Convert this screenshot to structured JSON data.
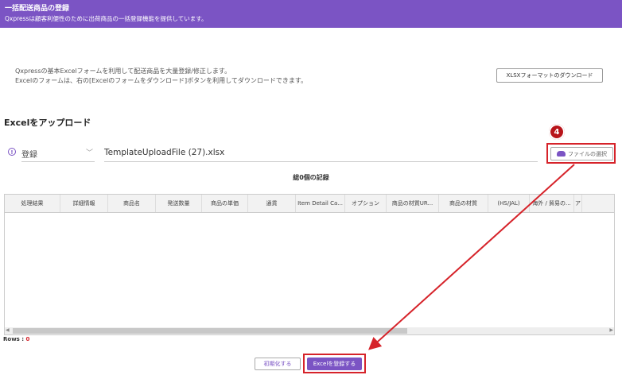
{
  "header": {
    "title": "一括配送商品の登録",
    "subtitle": "Qxpressは顧客利便性のために出荷商品の一括登録機能を提供しています。"
  },
  "intro": {
    "line1": "Qxpressの基本Excelフォームを利用して配送商品を大量登録/修正します。",
    "line2": "Excelのフォームは、右の[Excelのフォームをダウンロード]ボタンを利用してダウンロードできます。",
    "download_button": "XLSXフォーマットのダウンロード"
  },
  "upload": {
    "section_title": "Excelをアップロード",
    "info_glyph": "!",
    "mode_value": "登録",
    "chevron_glyph": "﹀",
    "file_name": "TemplateUploadFile (27).xlsx",
    "file_button": "ファイルの選択",
    "step_badge": "4"
  },
  "grid": {
    "records_label": "総0個の記録",
    "columns": [
      "処理結果",
      "詳細情報",
      "商品名",
      "発送数量",
      "商品の単価",
      "通貨",
      "Item Detail Ca...",
      "オプション",
      "商品の材質UR...",
      "商品の材質",
      "(HS/JAL)",
      "海外 / 貿易の...",
      "ア"
    ],
    "scroll_left": "◀",
    "scroll_right": "▶",
    "rows_label": "Rows : ",
    "rows_count": "0"
  },
  "actions": {
    "reset_button": "初期化する",
    "register_button": "Excelを登録する"
  },
  "colors": {
    "brand": "#7b54c4",
    "highlight": "#d6232a"
  }
}
